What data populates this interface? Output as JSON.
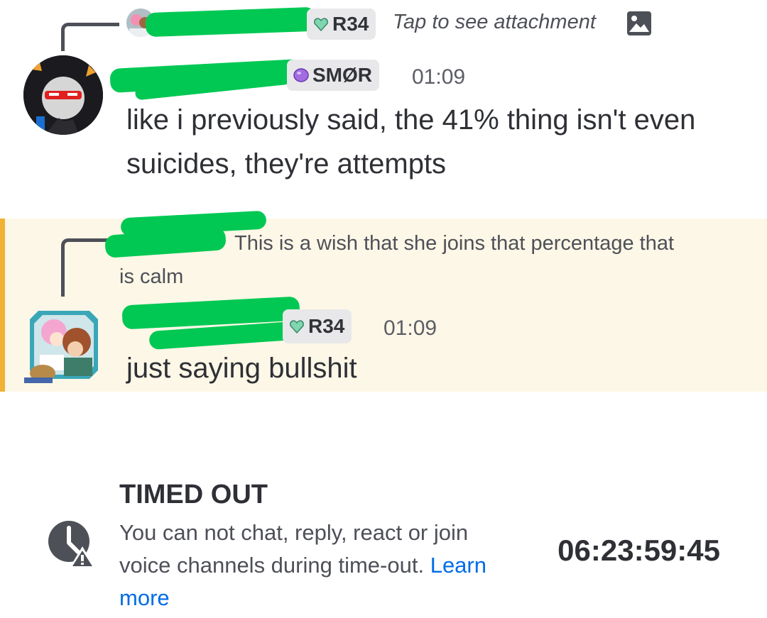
{
  "messages": [
    {
      "reply": {
        "role_tag": "R34",
        "text": "Tap to see attachment",
        "icon": "image-icon"
      },
      "role_tag": "SMØR",
      "time": "01:09",
      "text_line1": "like i previously said, the 41% thing isn't even",
      "text_line2": "suicides, they're attempts"
    },
    {
      "reply": {
        "text_line1": "This is a wish that she joins that percentage that",
        "text_line2": "is calm"
      },
      "role_tag": "R34",
      "time": "01:09",
      "text": "just saying bullshit",
      "highlighted": true
    }
  ],
  "timeout": {
    "icon": "clock-warning-icon",
    "title": "TIMED OUT",
    "desc_main": "You can not chat, reply, react or join voice channels during time-out.",
    "desc_link": "Learn more",
    "countdown": "06:23:59:45"
  },
  "colors": {
    "highlight_bg": "#fdf7e7",
    "highlight_bar": "#f0b232",
    "link": "#006ce7",
    "redaction": "#00c853"
  }
}
